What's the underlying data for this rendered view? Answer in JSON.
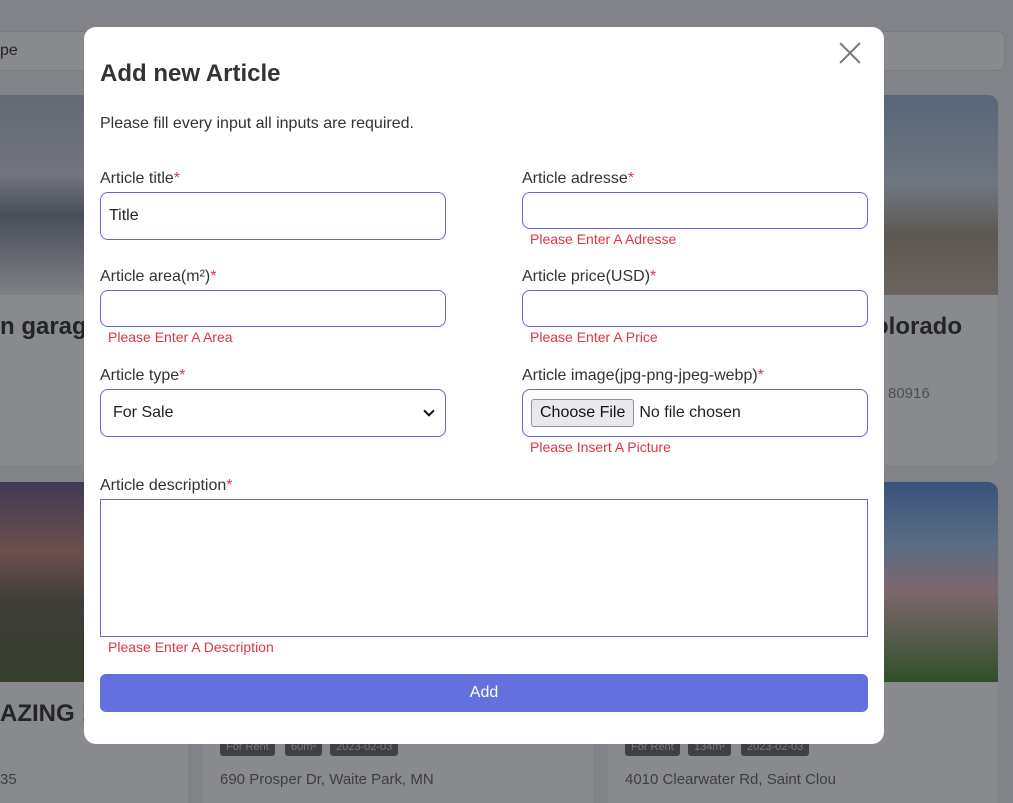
{
  "background": {
    "search_text": "pe",
    "cards": [
      {
        "title": "n garage",
        "sub": "",
        "address": ""
      },
      {
        "title": "olorado",
        "sub": "80916",
        "address": ""
      },
      {
        "title": "AZING !",
        "sub": "",
        "address": "35"
      },
      {
        "title": "",
        "tags": [
          "For Rent",
          "60m²",
          "2023-02-03"
        ],
        "address": "690 Prosper Dr, Waite Park, MN"
      },
      {
        "title": "",
        "tags": [
          "For Rent",
          "134m²",
          "2023-02-03"
        ],
        "address": "4010 Clearwater Rd, Saint Clou"
      }
    ]
  },
  "modal": {
    "title": "Add new Article",
    "note": "Please fill every input all inputs are required.",
    "required_mark": "*",
    "fields": {
      "title": {
        "label": "Article title",
        "value": "Title"
      },
      "address": {
        "label": "Article adresse",
        "value": "",
        "error": "Please Enter A Adresse"
      },
      "area": {
        "label": "Article area(m²)",
        "value": "",
        "error": "Please Enter A Area"
      },
      "price": {
        "label": "Article price(USD)",
        "value": "",
        "error": "Please Enter A Price"
      },
      "type": {
        "label": "Article type",
        "selected": "For Sale"
      },
      "image": {
        "label": "Article image(jpg-png-jpeg-webp)",
        "button": "Choose File",
        "status": "No file chosen",
        "error": "Please Insert A Picture"
      },
      "description": {
        "label": "Article description",
        "value": "",
        "error": "Please Enter A Description"
      }
    },
    "submit_label": "Add"
  },
  "colors": {
    "accent": "#6470de",
    "input_border": "#6466d6",
    "error": "#dc3545"
  }
}
